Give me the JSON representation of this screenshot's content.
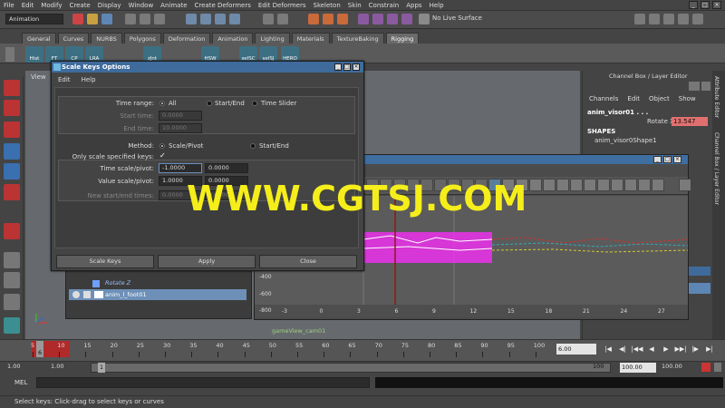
{
  "menubar": [
    "File",
    "Edit",
    "Modify",
    "Create",
    "Display",
    "Window",
    "Animate",
    "Create Deformers",
    "Edit Deformers",
    "Skeleton",
    "Skin",
    "Constrain",
    "Apps",
    "Help"
  ],
  "mode_selector": "Animation",
  "no_live_surface": "No Live Surface",
  "shelf_tabs": [
    "General",
    "Curves",
    "NURBS",
    "Polygons",
    "Deformation",
    "Animation",
    "Lighting",
    "Materials",
    "TextureBaking",
    "Rigging"
  ],
  "shelf_active_tab": "Rigging",
  "shelf_buttons": [
    "Hist",
    "FT",
    "CP",
    "LRA",
    "zJnt",
    "HSW",
    "selSC",
    "selSJ",
    "HERO"
  ],
  "viewport": {
    "menu": "View"
  },
  "channel_box": {
    "title": "Channel Box / Layer Editor",
    "menus": [
      "Channels",
      "Edit",
      "Object",
      "Show"
    ],
    "object_name": "anim_visor01 . . .",
    "rotate_label": "Rotate X",
    "rotate_value": "13.547",
    "shapes_header": "SHAPES",
    "shape_name": "anim_visor0Shape1"
  },
  "vertical_tabs": [
    "Attribute Editor",
    "Channel Box / Layer Editor"
  ],
  "graph_editor": {
    "ruler_numbers": [
      "-3",
      "0",
      "3",
      "6",
      "9",
      "12",
      "15",
      "18",
      "21",
      "24",
      "27"
    ],
    "value_labels": [
      "-400",
      "-600",
      "-800"
    ],
    "camera_label": "gameView_cam01"
  },
  "outliner": {
    "rows": [
      "Rotate Z",
      "anim_l_foot01"
    ]
  },
  "dialog": {
    "title": "Scale Keys Options",
    "menus": [
      "Edit",
      "Help"
    ],
    "time_range_label": "Time range:",
    "time_range_options": [
      "All",
      "Start/End",
      "Time Slider"
    ],
    "start_time_label": "Start time:",
    "start_time_value": "0.0000",
    "end_time_label": "End time:",
    "end_time_value": "10.0000",
    "method_label": "Method:",
    "method_options": [
      "Scale/Pivot",
      "Start/End"
    ],
    "only_scale_label": "Only scale specified keys:",
    "only_scale_check": "✓",
    "time_scale_label": "Time scale/pivot:",
    "time_scale_value": "-1.0000",
    "time_pivot_value": "0.0000",
    "value_scale_label": "Value scale/pivot:",
    "value_scale_value": "1.0000",
    "value_pivot_value": "0.0000",
    "new_start_end_label": "New start/end times:",
    "new_start_value": "0.0000",
    "new_end_value": "0.0000",
    "buttons": [
      "Scale Keys",
      "Apply",
      "Close"
    ]
  },
  "watermark": "WWW.CGTSJ.COM",
  "time_slider": {
    "numbers": [
      "5",
      "10",
      "15",
      "20",
      "25",
      "30",
      "35",
      "40",
      "45",
      "50",
      "55",
      "60",
      "65",
      "70",
      "75",
      "80",
      "85",
      "90",
      "95",
      "100"
    ],
    "current_frame": "6",
    "current_frame_field": "6.00"
  },
  "range_slider": {
    "start": "1.00",
    "inner_start": "1.00",
    "inner_marker": "1",
    "inner_end": "100",
    "end_field": "100.00",
    "end_outer": "100.00"
  },
  "mel_label": "MEL",
  "help_line": "Select keys: Click-drag to select keys or curves",
  "colors": {
    "titlebar": "#3e6b9c",
    "watermark": "#f5ee1a",
    "keys": "#b02a2a",
    "curve_magenta": "#ff2bff"
  }
}
